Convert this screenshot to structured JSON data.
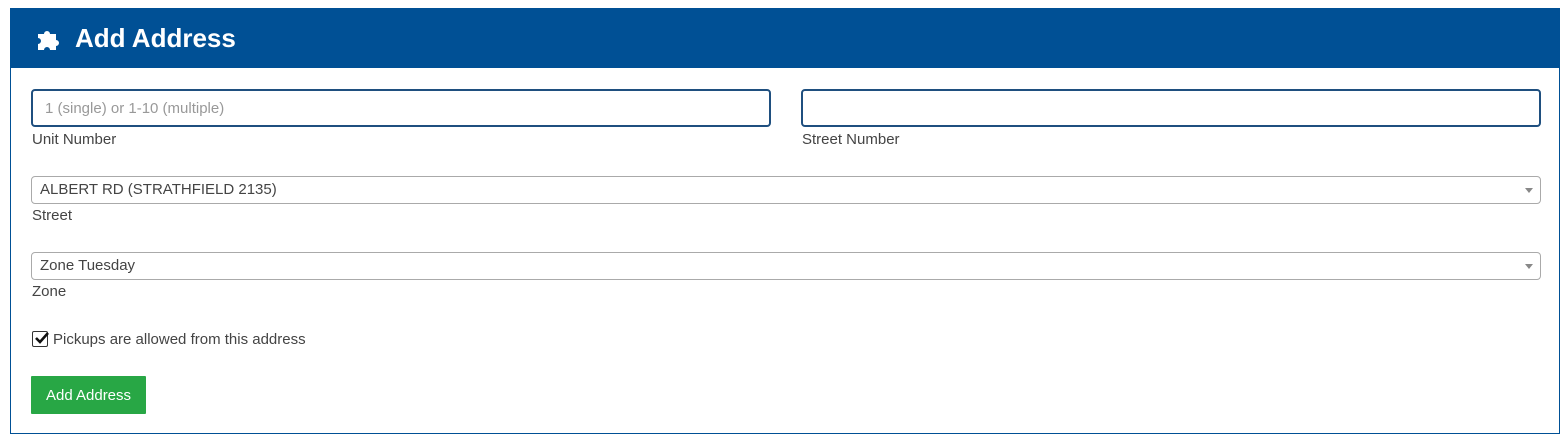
{
  "header": {
    "title": "Add Address",
    "icon": "puzzle-piece-icon"
  },
  "form": {
    "unit_number": {
      "placeholder": "1 (single) or 1-10 (multiple)",
      "value": "",
      "label": "Unit Number"
    },
    "street_number": {
      "placeholder": "",
      "value": "",
      "label": "Street Number"
    },
    "street": {
      "selected": "ALBERT RD (STRATHFIELD 2135)",
      "label": "Street"
    },
    "zone": {
      "selected": "Zone Tuesday",
      "label": "Zone"
    },
    "pickups": {
      "checked": true,
      "label": "Pickups are allowed from this address"
    },
    "submit_label": "Add Address"
  },
  "colors": {
    "header_bg": "#005095",
    "button_bg": "#28a745"
  }
}
